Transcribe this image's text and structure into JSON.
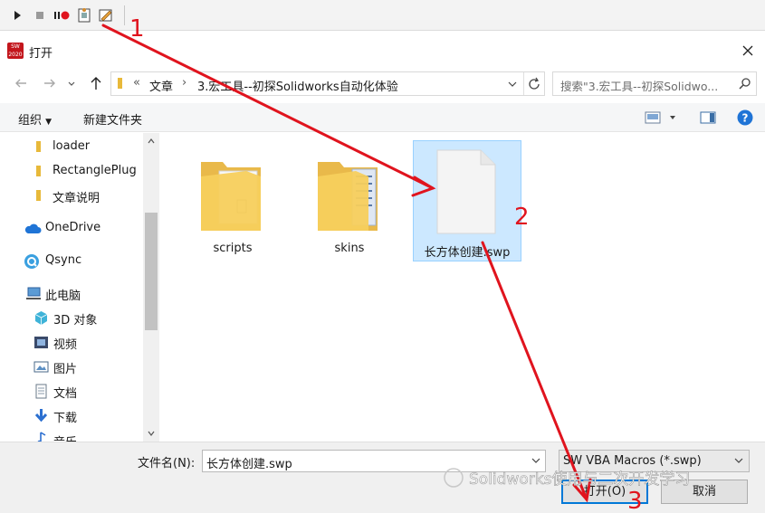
{
  "toolbar": {
    "icons": [
      "play-icon",
      "stop-icon",
      "pause-record-icon",
      "new-macro-icon",
      "edit-macro-icon"
    ]
  },
  "dialog": {
    "title": "打开"
  },
  "nav": {
    "breadcrumb": {
      "root": "文章",
      "current": "3.宏工具--初探Solidworks自动化体验"
    },
    "search_placeholder": "搜索\"3.宏工具--初探Solidwo..."
  },
  "commands": {
    "organize": "组织",
    "new_folder": "新建文件夹"
  },
  "sidebar": {
    "items": [
      {
        "label": "loader",
        "icon": "folder-icon"
      },
      {
        "label": "RectanglePlug",
        "icon": "folder-icon"
      },
      {
        "label": "文章说明",
        "icon": "folder-icon"
      },
      {
        "label": "OneDrive",
        "icon": "cloud-icon"
      },
      {
        "label": "Qsync",
        "icon": "qsync-icon"
      },
      {
        "label": "此电脑",
        "icon": "computer-icon"
      },
      {
        "label": "3D 对象",
        "icon": "cube-icon"
      },
      {
        "label": "视频",
        "icon": "video-icon"
      },
      {
        "label": "图片",
        "icon": "picture-icon"
      },
      {
        "label": "文档",
        "icon": "document-icon"
      },
      {
        "label": "下载",
        "icon": "download-icon"
      },
      {
        "label": "音乐",
        "icon": "music-icon"
      }
    ]
  },
  "files": [
    {
      "name": "scripts",
      "type": "folder"
    },
    {
      "name": "skins",
      "type": "folder"
    },
    {
      "name": "长方体创建.swp",
      "type": "file",
      "selected": true
    }
  ],
  "bottom": {
    "filename_label": "文件名(N):",
    "filename_value": "长方体创建.swp",
    "filter_value": "SW VBA Macros (*.swp)",
    "open_label": "打开(O)",
    "cancel_label": "取消"
  },
  "annotations": {
    "step1": "1",
    "step2": "2",
    "step3": "3",
    "watermark": "Solidworks使用与二次开发学习"
  },
  "colors": {
    "accent": "#0078d7",
    "selection": "#cce8ff",
    "annotation": "#e0141e",
    "folder": "#f7cf5c"
  }
}
